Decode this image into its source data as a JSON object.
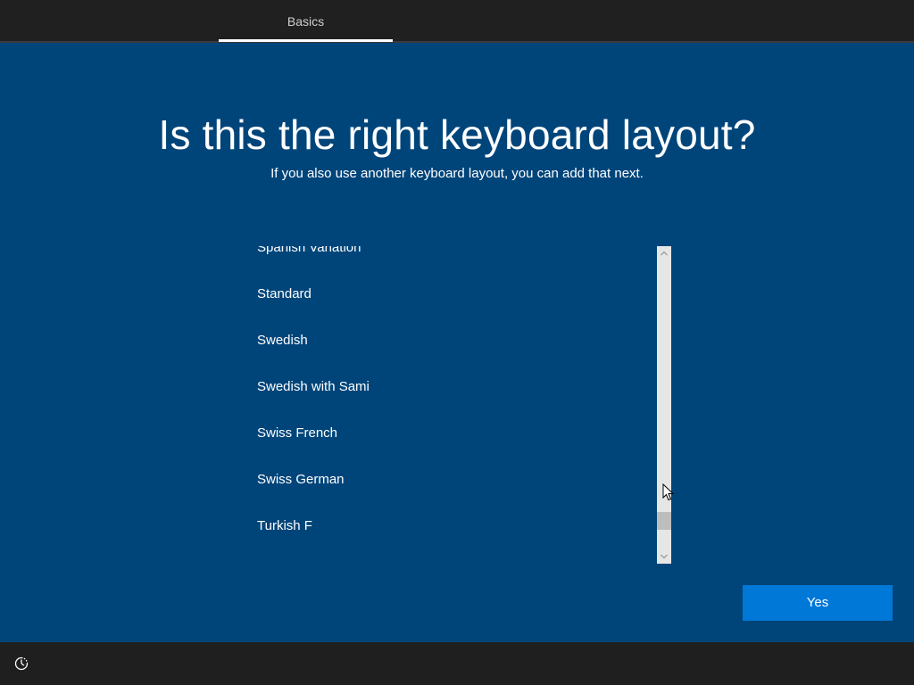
{
  "header": {
    "tab_label": "Basics"
  },
  "main": {
    "title": "Is this the right keyboard layout?",
    "subtitle": "If you also use another keyboard layout, you can add that next.",
    "layouts": [
      "Spanish Variation",
      "Standard",
      "Swedish",
      "Swedish with Sami",
      "Swiss French",
      "Swiss German",
      "Turkish F"
    ],
    "yes_label": "Yes"
  },
  "icons": {
    "scroll_up": "chevron-up-icon",
    "scroll_down": "chevron-down-icon",
    "accessibility": "ease-of-access-icon",
    "cursor": "mouse-cursor-icon"
  },
  "colors": {
    "background": "#00457a",
    "top_bar": "#202020",
    "bottom_bar": "#1f1f1f",
    "button": "#0078d7",
    "text": "#ffffff"
  }
}
